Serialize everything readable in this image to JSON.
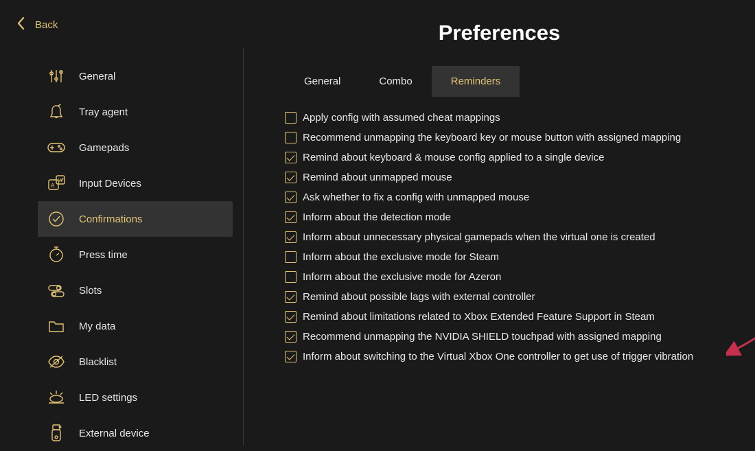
{
  "back_label": "Back",
  "page_title": "Preferences",
  "sidebar": {
    "items": [
      {
        "label": "General",
        "active": false,
        "icon": "sliders"
      },
      {
        "label": "Tray agent",
        "active": false,
        "icon": "bell"
      },
      {
        "label": "Gamepads",
        "active": false,
        "icon": "gamepad"
      },
      {
        "label": "Input Devices",
        "active": false,
        "icon": "input-device"
      },
      {
        "label": "Confirmations",
        "active": true,
        "icon": "check-circle"
      },
      {
        "label": "Press time",
        "active": false,
        "icon": "stopwatch"
      },
      {
        "label": "Slots",
        "active": false,
        "icon": "slots"
      },
      {
        "label": "My data",
        "active": false,
        "icon": "folder"
      },
      {
        "label": "Blacklist",
        "active": false,
        "icon": "eye-off"
      },
      {
        "label": "LED settings",
        "active": false,
        "icon": "led"
      },
      {
        "label": "External device",
        "active": false,
        "icon": "usb"
      }
    ]
  },
  "tabs": [
    {
      "label": "General",
      "active": false
    },
    {
      "label": "Combo",
      "active": false
    },
    {
      "label": "Reminders",
      "active": true
    }
  ],
  "reminders": [
    {
      "label": "Apply config with assumed cheat mappings",
      "checked": false
    },
    {
      "label": "Recommend unmapping the keyboard key or mouse button with assigned mapping",
      "checked": false
    },
    {
      "label": "Remind about keyboard & mouse config applied to a single device",
      "checked": true
    },
    {
      "label": "Remind about unmapped mouse",
      "checked": true
    },
    {
      "label": "Ask whether to fix a config with unmapped mouse",
      "checked": true
    },
    {
      "label": "Inform about the detection mode",
      "checked": true
    },
    {
      "label": "Inform about unnecessary physical gamepads when the virtual one is created",
      "checked": true
    },
    {
      "label": "Inform about the exclusive mode for Steam",
      "checked": false
    },
    {
      "label": "Inform about the exclusive mode for Azeron",
      "checked": false
    },
    {
      "label": "Remind about possible lags with external controller",
      "checked": true
    },
    {
      "label": "Remind about limitations related to Xbox Extended Feature Support in Steam",
      "checked": true
    },
    {
      "label": "Recommend unmapping the NVIDIA SHIELD touchpad with assigned mapping",
      "checked": true
    },
    {
      "label": "Inform about switching to the Virtual Xbox One controller to get use of trigger vibration",
      "checked": true
    }
  ],
  "annotation": {
    "arrow_color": "#c5304e"
  }
}
